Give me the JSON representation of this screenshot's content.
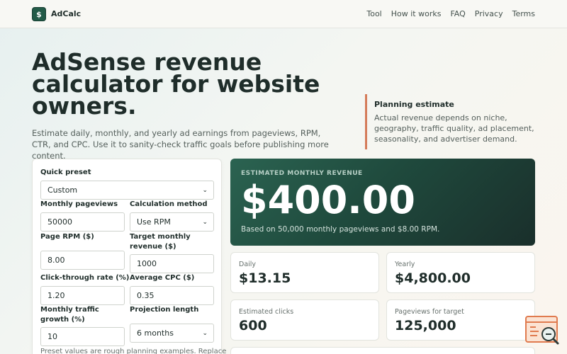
{
  "header": {
    "logo_symbol": "$",
    "brand": "AdCalc",
    "nav": [
      "Tool",
      "How it works",
      "FAQ",
      "Privacy",
      "Terms"
    ]
  },
  "hero": {
    "title": "AdSense revenue calculator for website owners.",
    "subtitle": "Estimate daily, monthly, and yearly ad earnings from pageviews, RPM, CTR, and CPC. Use it to sanity-check traffic goals before publishing more content."
  },
  "note": {
    "title": "Planning estimate",
    "text": "Actual revenue depends on niche, geography, traffic quality, ad placement, seasonality, and advertiser demand."
  },
  "form": {
    "quick_preset_label": "Quick preset",
    "quick_preset_value": "Custom",
    "monthly_pageviews_label": "Monthly pageviews",
    "monthly_pageviews_value": "50000",
    "calc_method_label": "Calculation method",
    "calc_method_value": "Use RPM",
    "page_rpm_label": "Page RPM ($)",
    "page_rpm_value": "8.00",
    "target_revenue_label": "Target monthly revenue ($)",
    "target_revenue_value": "1000",
    "ctr_label": "Click-through rate (%)",
    "ctr_value": "1.20",
    "cpc_label": "Average CPC ($)",
    "cpc_value": "0.35",
    "growth_label": "Monthly traffic growth (%)",
    "growth_value": "10",
    "projection_label": "Projection length",
    "projection_value": "6 months",
    "hint": "Preset values are rough planning examples. Replace"
  },
  "results": {
    "main_label": "ESTIMATED MONTHLY REVENUE",
    "main_value": "$400.00",
    "main_note": "Based on 50,000 monthly pageviews and $8.00 RPM.",
    "daily_label": "Daily",
    "daily_value": "$13.15",
    "yearly_label": "Yearly",
    "yearly_value": "$4,800.00",
    "clicks_label": "Estimated clicks",
    "clicks_value": "600",
    "target_pv_label": "Pageviews for target",
    "target_pv_value": "125,000"
  },
  "icons": {
    "logo": "dollar-icon",
    "chevron": "chevron-down-icon",
    "fab": "search-document-icon"
  },
  "colors": {
    "accent_green": "#235b48",
    "accent_orange": "#d57c5a"
  }
}
